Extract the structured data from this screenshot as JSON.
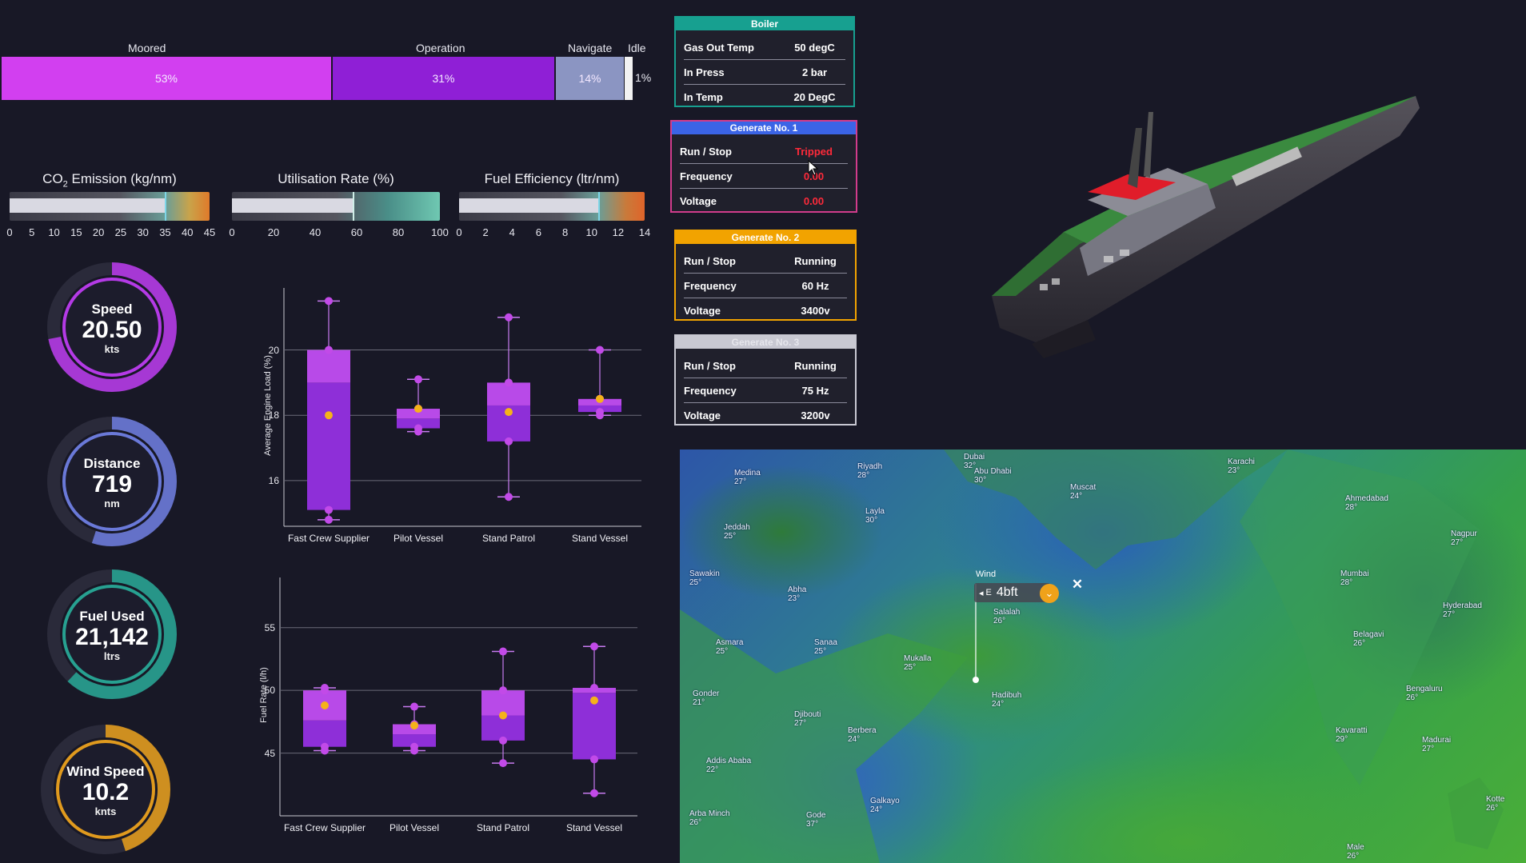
{
  "operation_modes": [
    {
      "label": "Moored",
      "pct": "53%",
      "color": "#d23ff0",
      "value": 53
    },
    {
      "label": "Operation",
      "pct": "31%",
      "color": "#8f1fd6",
      "value": 31
    },
    {
      "label": "Navigate",
      "pct": "14%",
      "color": "#8b95c2",
      "value": 14
    },
    {
      "label": "Idle",
      "pct": "1%",
      "color": "#f2f2f2",
      "value": 1
    }
  ],
  "gauges": [
    {
      "title_pre": "CO",
      "title_sub": "2",
      "title_post": " Emission (kg/nm)",
      "ticks": [
        "0",
        "5",
        "10",
        "15",
        "20",
        "25",
        "30",
        "35",
        "40",
        "45"
      ],
      "value": 35,
      "max": 45
    },
    {
      "title_pre": "Utilisation Rate (%)",
      "title_sub": "",
      "title_post": "",
      "ticks": [
        "0",
        "20",
        "40",
        "60",
        "80",
        "100"
      ],
      "value": 58,
      "max": 100
    },
    {
      "title_pre": "Fuel Efficiency (ltr/nm)",
      "title_sub": "",
      "title_post": "",
      "ticks": [
        "0",
        "2",
        "4",
        "6",
        "8",
        "10",
        "12",
        "14"
      ],
      "value": 10.5,
      "max": 14
    }
  ],
  "kpis": [
    {
      "label": "Speed",
      "value": "20.50",
      "unit": "kts",
      "color": "#b43ae6",
      "fraction": 0.72
    },
    {
      "label": "Distance",
      "value": "719",
      "unit": "nm",
      "color": "#6a79d8",
      "fraction": 0.55
    },
    {
      "label": "Fuel Used",
      "value": "21,142",
      "unit": "ltrs",
      "color": "#27a191",
      "fraction": 0.62
    },
    {
      "label": "Wind Speed",
      "value": "10.2",
      "unit": "knts",
      "color": "#e09a1e",
      "fraction": 0.45
    }
  ],
  "panels": {
    "boiler": {
      "title": "Boiler",
      "color": "#17a090",
      "rows": [
        [
          "Gas Out Temp",
          "50 degC"
        ],
        [
          "In Press",
          "2 bar"
        ],
        [
          "In Temp",
          "20 DegC"
        ]
      ]
    },
    "gen1": {
      "title": "Generate No. 1",
      "color": "#3b64e6",
      "border": "#d13c8c",
      "rows": [
        [
          "Run / Stop",
          "Tripped"
        ],
        [
          "Frequency",
          "0.00"
        ],
        [
          "Voltage",
          "0.00"
        ]
      ],
      "alert_color": "#ff2a3a"
    },
    "gen2": {
      "title": "Generate No. 2",
      "color": "#f2a300",
      "rows": [
        [
          "Run / Stop",
          "Running"
        ],
        [
          "Frequency",
          "60 Hz"
        ],
        [
          "Voltage",
          "3400v"
        ]
      ]
    },
    "gen3": {
      "title": "Generate No. 3",
      "color": "#c8c8d2",
      "rows": [
        [
          "Run / Stop",
          "Running"
        ],
        [
          "Frequency",
          "75 Hz"
        ],
        [
          "Voltage",
          "3200v"
        ]
      ]
    }
  },
  "chart_data": [
    {
      "type": "box",
      "ylabel": "Average Engine Load (%)",
      "yticks": [
        16,
        18,
        20
      ],
      "ylim": [
        14.6,
        21.9
      ],
      "categories": [
        "Fast Crew Supplier",
        "Pilot Vessel",
        "Stand Patrol",
        "Stand Vessel"
      ],
      "boxes": [
        {
          "min": 14.8,
          "q1": 15.1,
          "median": 19.0,
          "q3": 20.0,
          "max": 21.5,
          "mean": 18.0
        },
        {
          "min": 17.5,
          "q1": 17.6,
          "median": 17.9,
          "q3": 18.2,
          "max": 19.1,
          "mean": 18.2
        },
        {
          "min": 15.5,
          "q1": 17.2,
          "median": 18.3,
          "q3": 19.0,
          "max": 21.0,
          "mean": 18.1
        },
        {
          "min": 18.0,
          "q1": 18.1,
          "median": 18.3,
          "q3": 18.5,
          "max": 20.0,
          "mean": 18.5
        }
      ]
    },
    {
      "type": "box",
      "ylabel": "Fuel Rate (l/h)",
      "yticks": [
        45,
        50,
        55
      ],
      "ylim": [
        40,
        59
      ],
      "categories": [
        "Fast Crew Supplier",
        "Pilot Vessel",
        "Stand Patrol",
        "Stand Vessel"
      ],
      "boxes": [
        {
          "min": 45.2,
          "q1": 45.5,
          "median": 47.6,
          "q3": 50.0,
          "max": 50.2,
          "mean": 48.8
        },
        {
          "min": 45.2,
          "q1": 45.5,
          "median": 46.5,
          "q3": 47.3,
          "max": 48.7,
          "mean": 47.2
        },
        {
          "min": 44.2,
          "q1": 46.0,
          "median": 48.0,
          "q3": 50.0,
          "max": 53.1,
          "mean": 48.0
        },
        {
          "min": 41.8,
          "q1": 44.5,
          "median": 49.8,
          "q3": 50.2,
          "max": 53.5,
          "mean": 49.2
        }
      ]
    }
  ],
  "map": {
    "wind_label": "Wind",
    "wind_value": "4bft",
    "wind_dir": "E",
    "cities": [
      [
        "Medina",
        "27°",
        918,
        586
      ],
      [
        "Riyadh",
        "28°",
        1072,
        578
      ],
      [
        "Dubai",
        "32°",
        1205,
        566
      ],
      [
        "Abu Dhabi",
        "30°",
        1218,
        584
      ],
      [
        "Muscat",
        "24°",
        1338,
        604
      ],
      [
        "Karachi",
        "23°",
        1535,
        572
      ],
      [
        "Ahmedabad",
        "28°",
        1682,
        618
      ],
      [
        "Nagpur",
        "27°",
        1814,
        662
      ],
      [
        "Jeddah",
        "25°",
        905,
        654
      ],
      [
        "Layla",
        "30°",
        1082,
        634
      ],
      [
        "Mumbai",
        "28°",
        1676,
        712
      ],
      [
        "Hyderabad",
        "27°",
        1804,
        752
      ],
      [
        "Sawakin",
        "25°",
        862,
        712
      ],
      [
        "Abha",
        "23°",
        985,
        732
      ],
      [
        "Salalah",
        "26°",
        1242,
        760
      ],
      [
        "Belagavi",
        "26°",
        1692,
        788
      ],
      [
        "Asmara",
        "25°",
        895,
        798
      ],
      [
        "Sanaa",
        "25°",
        1018,
        798
      ],
      [
        "Mukalla",
        "25°",
        1130,
        818
      ],
      [
        "Bengaluru",
        "26°",
        1758,
        856
      ],
      [
        "Gonder",
        "21°",
        866,
        862
      ],
      [
        "Djibouti",
        "27°",
        993,
        888
      ],
      [
        "Hadibuh",
        "24°",
        1240,
        864
      ],
      [
        "Kavaratti",
        "29°",
        1670,
        908
      ],
      [
        "Berbera",
        "24°",
        1060,
        908
      ],
      [
        "Madurai",
        "27°",
        1778,
        920
      ],
      [
        "Addis Ababa",
        "22°",
        883,
        946
      ],
      [
        "Galkayo",
        "24°",
        1088,
        996
      ],
      [
        "Arba Minch",
        "26°",
        862,
        1012
      ],
      [
        "Gode",
        "37°",
        1008,
        1014
      ],
      [
        "Kotte",
        "26°",
        1858,
        994
      ],
      [
        "Male",
        "26°",
        1684,
        1054
      ]
    ]
  }
}
